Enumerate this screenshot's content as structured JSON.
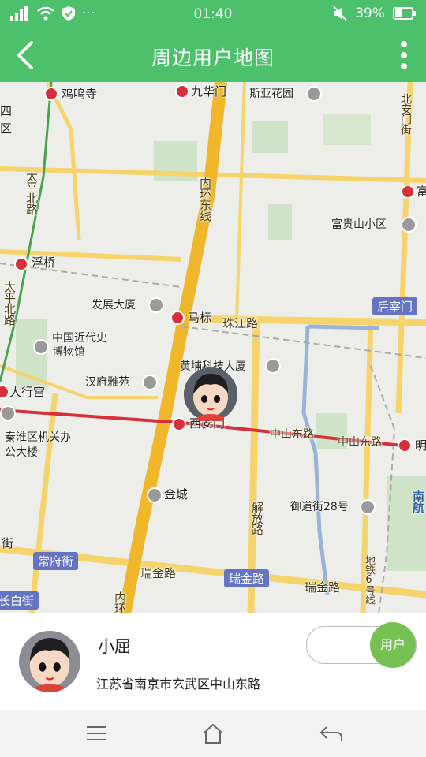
{
  "status_bar": {
    "time": "01:40",
    "battery": "39%",
    "icons": [
      "signal-icon",
      "wifi-icon",
      "shield-icon",
      "more-dots-icon",
      "mute-icon",
      "battery-icon"
    ]
  },
  "app_bar": {
    "title": "周边用户地图",
    "icons": [
      "back-icon",
      "more-vertical-icon"
    ]
  },
  "map": {
    "labels": {
      "jimingsi": "鸡鸣寺",
      "jiuhuamen": "九华门",
      "siyahuayuan": "斯亚花园",
      "beianmen": "北安门街",
      "taipingbeilu": "太平北路",
      "neihuandongxian": "内环东线",
      "fuqiao": "浮桥",
      "fuguishan": "富贵山小区",
      "fu": "富",
      "fazhan": "发展大厦",
      "mabiao": "马标",
      "zhujianglu": "珠江路",
      "houzaimen": "后宰门",
      "museum": "中国近代史博物馆",
      "huangpu": "黄埔科技大厦",
      "hanfu": "汉府雅苑",
      "daxinggong": "大行宫",
      "xianmen": "西安门",
      "zhongshandonglu_1": "中山东路",
      "zhongshandonglu_2": "中山东路",
      "ming": "明",
      "qinhuai": "秦淮区机关办公大楼",
      "jincheng": "金城",
      "yudaojie": "御道街28号",
      "jiefanglu": "解放路",
      "nanhang": "南航",
      "jie": "街",
      "changfujie": "常府街",
      "ruijinlu_1": "瑞金路",
      "ruijinlu_tag": "瑞金路",
      "ruijinlu_2": "瑞金路",
      "changbaijie": "长白街",
      "ditie": "地铁6号线",
      "si": "四",
      "qu": "区",
      "neihuan_bottom": "内环"
    }
  },
  "user_card": {
    "name": "小屈",
    "address": "江苏省南京市玄武区中山东路",
    "toggle_label": "用户"
  },
  "nav_bar": {
    "icons": [
      "menu-icon",
      "home-icon",
      "back-arrow-icon"
    ]
  },
  "colors": {
    "primary": "#4cc06b",
    "toggle_green": "#76c054",
    "map_bg": "#ededea",
    "road_yellow": "#f5d46b",
    "road_orange": "#f0b72a",
    "metro_red": "#d6303a",
    "tag_blue": "#6573c3"
  }
}
